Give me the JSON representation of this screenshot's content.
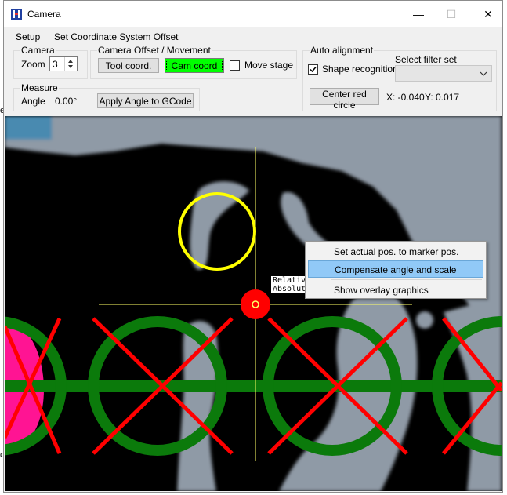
{
  "window": {
    "title": "Camera",
    "controls": [
      "—",
      "☐",
      "✕"
    ]
  },
  "menu": {
    "items": [
      "Setup",
      "Set Coordinate System Offset"
    ]
  },
  "camera_group": {
    "legend": "Camera",
    "zoom_label": "Zoom",
    "zoom_value": "3"
  },
  "offset_group": {
    "legend": "Camera Offset / Movement",
    "tool_coord_label": "Tool coord.",
    "cam_coord_label": "Cam coord",
    "move_stage_label": "Move stage",
    "move_stage_checked": false
  },
  "measure_group": {
    "legend": "Measure",
    "angle_label": "Angle",
    "angle_value": "0.00°",
    "apply_angle_label": "Apply Angle to GCode"
  },
  "auto_alignment": {
    "legend": "Auto alignment",
    "shape_recognition_label": "Shape recognition",
    "shape_recognition_checked": true,
    "filter_label": "Select filter set",
    "filter_value": "",
    "center_button_label": "Center red circle",
    "x_readout": "X: -0.040",
    "y_readout": "Y: 0.017"
  },
  "overlay": {
    "label_line1": "Relativ",
    "label_line2": "Absolut"
  },
  "context_menu": {
    "items": [
      {
        "label": "Set actual pos. to marker pos.",
        "highlighted": false
      },
      {
        "label": "Compensate angle and scale",
        "highlighted": true
      },
      {
        "label": "Show overlay graphics",
        "highlighted": false
      }
    ]
  },
  "background_window_glyphs": [
    "e",
    "c"
  ],
  "colors": {
    "cam_coord_active": "#00ff00",
    "context_highlight": "#91c9f7",
    "marker_yellow": "#ffff00",
    "target_red": "#ff0000",
    "pad_green": "#007a00",
    "pad_magenta": "#ff1493",
    "crosshair": "#ffff66"
  }
}
